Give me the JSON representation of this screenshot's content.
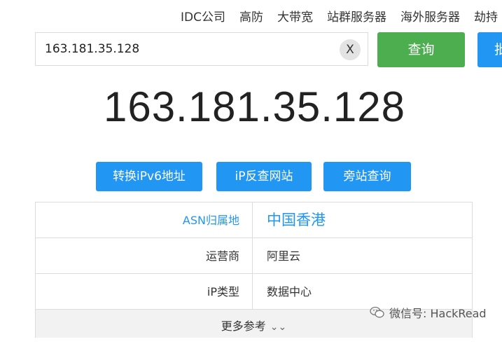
{
  "topnav": {
    "items": [
      "IDC公司",
      "高防",
      "大带宽",
      "站群服务器",
      "海外服务器",
      "劫持"
    ]
  },
  "search": {
    "value": "163.181.35.128",
    "clear_label": "X",
    "query_label": "查询",
    "extra_label": "批"
  },
  "result": {
    "ip": "163.181.35.128"
  },
  "actions": {
    "ipv6": "转换iPv6地址",
    "reverse": "iP反查网站",
    "sidesite": "旁站查询"
  },
  "table": {
    "rows": [
      {
        "label": "ASN归属地",
        "value": "中国香港"
      },
      {
        "label": "运营商",
        "value": "阿里云"
      },
      {
        "label": "iP类型",
        "value": "数据中心"
      }
    ],
    "more_label": "更多参考"
  },
  "watermark": {
    "text": "微信号: HackRead",
    "icon": "wechat-icon"
  }
}
